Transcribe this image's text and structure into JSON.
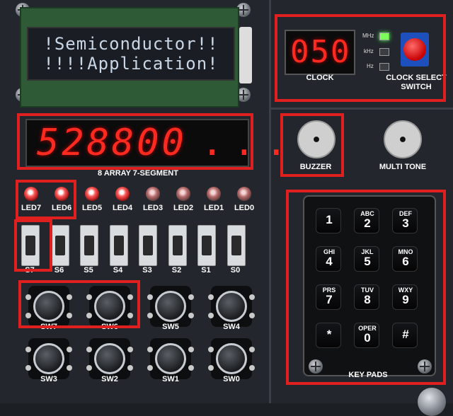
{
  "lcd": {
    "line1": "!Semiconductor!!",
    "line2": "!!!!Application!"
  },
  "segment": {
    "display": "528800",
    "dots": "...",
    "label": "8 ARRAY 7-SEGMENT"
  },
  "leds": [
    {
      "label": "LED7",
      "state": "on"
    },
    {
      "label": "LED6",
      "state": "on"
    },
    {
      "label": "LED5",
      "state": "on"
    },
    {
      "label": "LED4",
      "state": "on"
    },
    {
      "label": "LED3",
      "state": "off"
    },
    {
      "label": "LED2",
      "state": "off"
    },
    {
      "label": "LED1",
      "state": "off"
    },
    {
      "label": "LED0",
      "state": "off"
    }
  ],
  "slide_switches": [
    "S7",
    "S6",
    "S5",
    "S4",
    "S3",
    "S2",
    "S1",
    "S0"
  ],
  "push_buttons": [
    "SW7",
    "SW6",
    "SW5",
    "SW4",
    "SW3",
    "SW2",
    "SW1",
    "SW0"
  ],
  "clock": {
    "value": "050",
    "label": "CLOCK",
    "units": [
      "MHz",
      "kHz",
      "Hz"
    ],
    "active_unit": "MHz",
    "select_label_1": "CLOCK SELECT",
    "select_label_2": "SWITCH"
  },
  "buzzer": {
    "label": "BUZZER"
  },
  "multitone": {
    "label": "MULTI TONE"
  },
  "keypad": {
    "label": "KEY PADS",
    "keys": [
      {
        "main": "1",
        "sub": ""
      },
      {
        "main": "2",
        "sub": "ABC"
      },
      {
        "main": "3",
        "sub": "DEF"
      },
      {
        "main": "4",
        "sub": "GHI"
      },
      {
        "main": "5",
        "sub": "JKL"
      },
      {
        "main": "6",
        "sub": "MNO"
      },
      {
        "main": "7",
        "sub": "PRS"
      },
      {
        "main": "8",
        "sub": "TUV"
      },
      {
        "main": "9",
        "sub": "WXY"
      },
      {
        "main": "*",
        "sub": ""
      },
      {
        "main": "0",
        "sub": "OPER"
      },
      {
        "main": "#",
        "sub": ""
      }
    ]
  },
  "colors": {
    "highlight": "#e01f1f",
    "segment": "#ff2a1f",
    "board": "#23272d"
  }
}
